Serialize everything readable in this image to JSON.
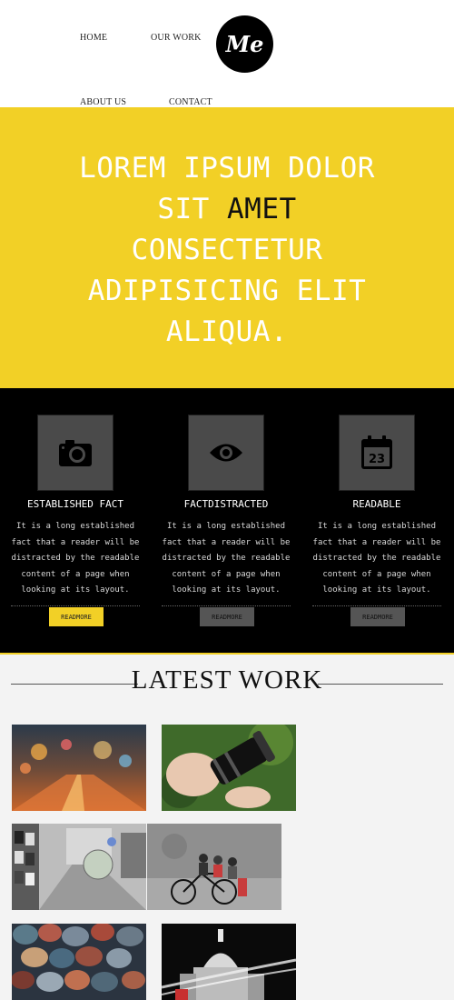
{
  "nav": {
    "home": "HOME",
    "our_work": "OUR WORK",
    "about_us": "ABOUT US",
    "contact": "CONTACT"
  },
  "logo": {
    "text": "Me"
  },
  "hero": {
    "lines": [
      {
        "parts": [
          {
            "text": "LOREM IPSUM DOLOR",
            "color": "light"
          }
        ]
      },
      {
        "parts": [
          {
            "text": "SIT ",
            "color": "light"
          },
          {
            "text": "AMET",
            "color": "dark"
          }
        ]
      },
      {
        "parts": [
          {
            "text": "CONSECTETUR",
            "color": "light"
          }
        ]
      },
      {
        "parts": [
          {
            "text": "ADIPISICING ELIT",
            "color": "light"
          }
        ]
      },
      {
        "parts": [
          {
            "text": "ALIQUA.",
            "color": "light"
          }
        ]
      }
    ],
    "background": "#f2d026"
  },
  "features": [
    {
      "icon": "camera-icon",
      "title": "ESTABLISHED FACT",
      "text": "It is a long established fact that a reader will be distracted by the readable content of a page when looking at its layout.",
      "button": "READMORE",
      "button_style": "yellow"
    },
    {
      "icon": "eye-icon",
      "title": "FACTDISTRACTED",
      "text": "It is a long established fact that a reader will be distracted by the readable content of a page when looking at its layout.",
      "button": "READMORE",
      "button_style": "gray"
    },
    {
      "icon": "calendar-icon",
      "title": "READABLE",
      "text": "It is a long established fact that a reader will be distracted by the readable content of a page when looking at its layout.",
      "button": "READMORE",
      "button_style": "gray",
      "calendar_day": "23"
    }
  ],
  "latest_work": {
    "title": "LATEST WORK",
    "thumbnails": [
      {
        "name": "city-lights-thumbnail"
      },
      {
        "name": "camera-lens-thumbnail"
      },
      {
        "name": "street-gallery-thumbnail"
      },
      {
        "name": "children-bicycle-thumbnail"
      },
      {
        "name": "stones-thumbnail"
      },
      {
        "name": "night-cathedral-thumbnail"
      }
    ]
  },
  "colors": {
    "accent": "#f2d026",
    "dark": "#000000",
    "light_bg": "#f3f3f3"
  }
}
